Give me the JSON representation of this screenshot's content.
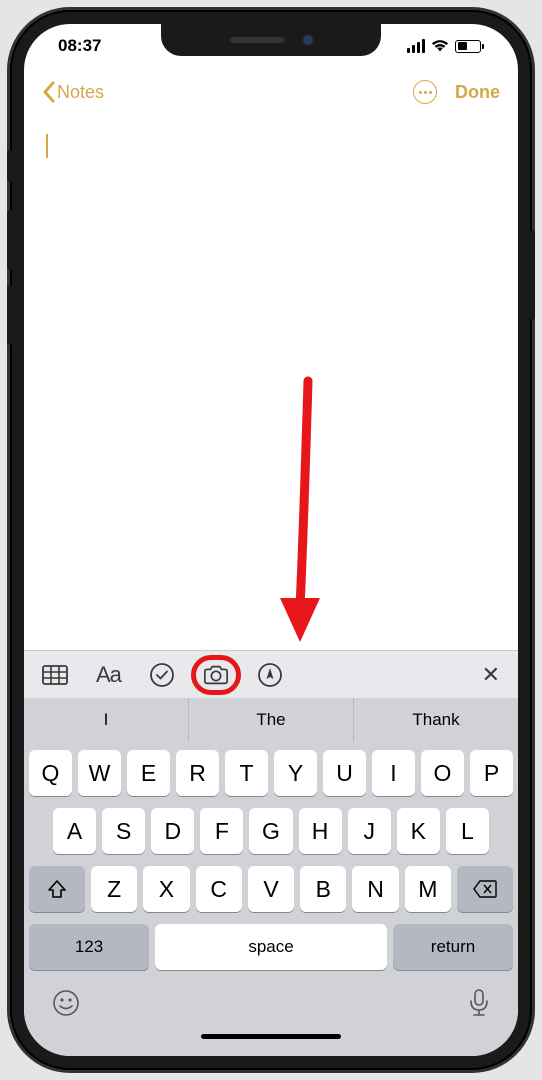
{
  "status_bar": {
    "time": "08:37"
  },
  "nav": {
    "back_label": "Notes",
    "done_label": "Done"
  },
  "toolbar": {
    "text_format_label": "Aa"
  },
  "predictive": {
    "suggestions": [
      "I",
      "The",
      "Thank"
    ]
  },
  "keyboard": {
    "row1": [
      "Q",
      "W",
      "E",
      "R",
      "T",
      "Y",
      "U",
      "I",
      "O",
      "P"
    ],
    "row2": [
      "A",
      "S",
      "D",
      "F",
      "G",
      "H",
      "J",
      "K",
      "L"
    ],
    "row3": [
      "Z",
      "X",
      "C",
      "V",
      "B",
      "N",
      "M"
    ],
    "numbers_label": "123",
    "space_label": "space",
    "return_label": "return"
  },
  "annotation": {
    "type": "arrow",
    "target": "camera-button"
  },
  "colors": {
    "accent": "#d4a947",
    "annotation": "#e6161b"
  }
}
